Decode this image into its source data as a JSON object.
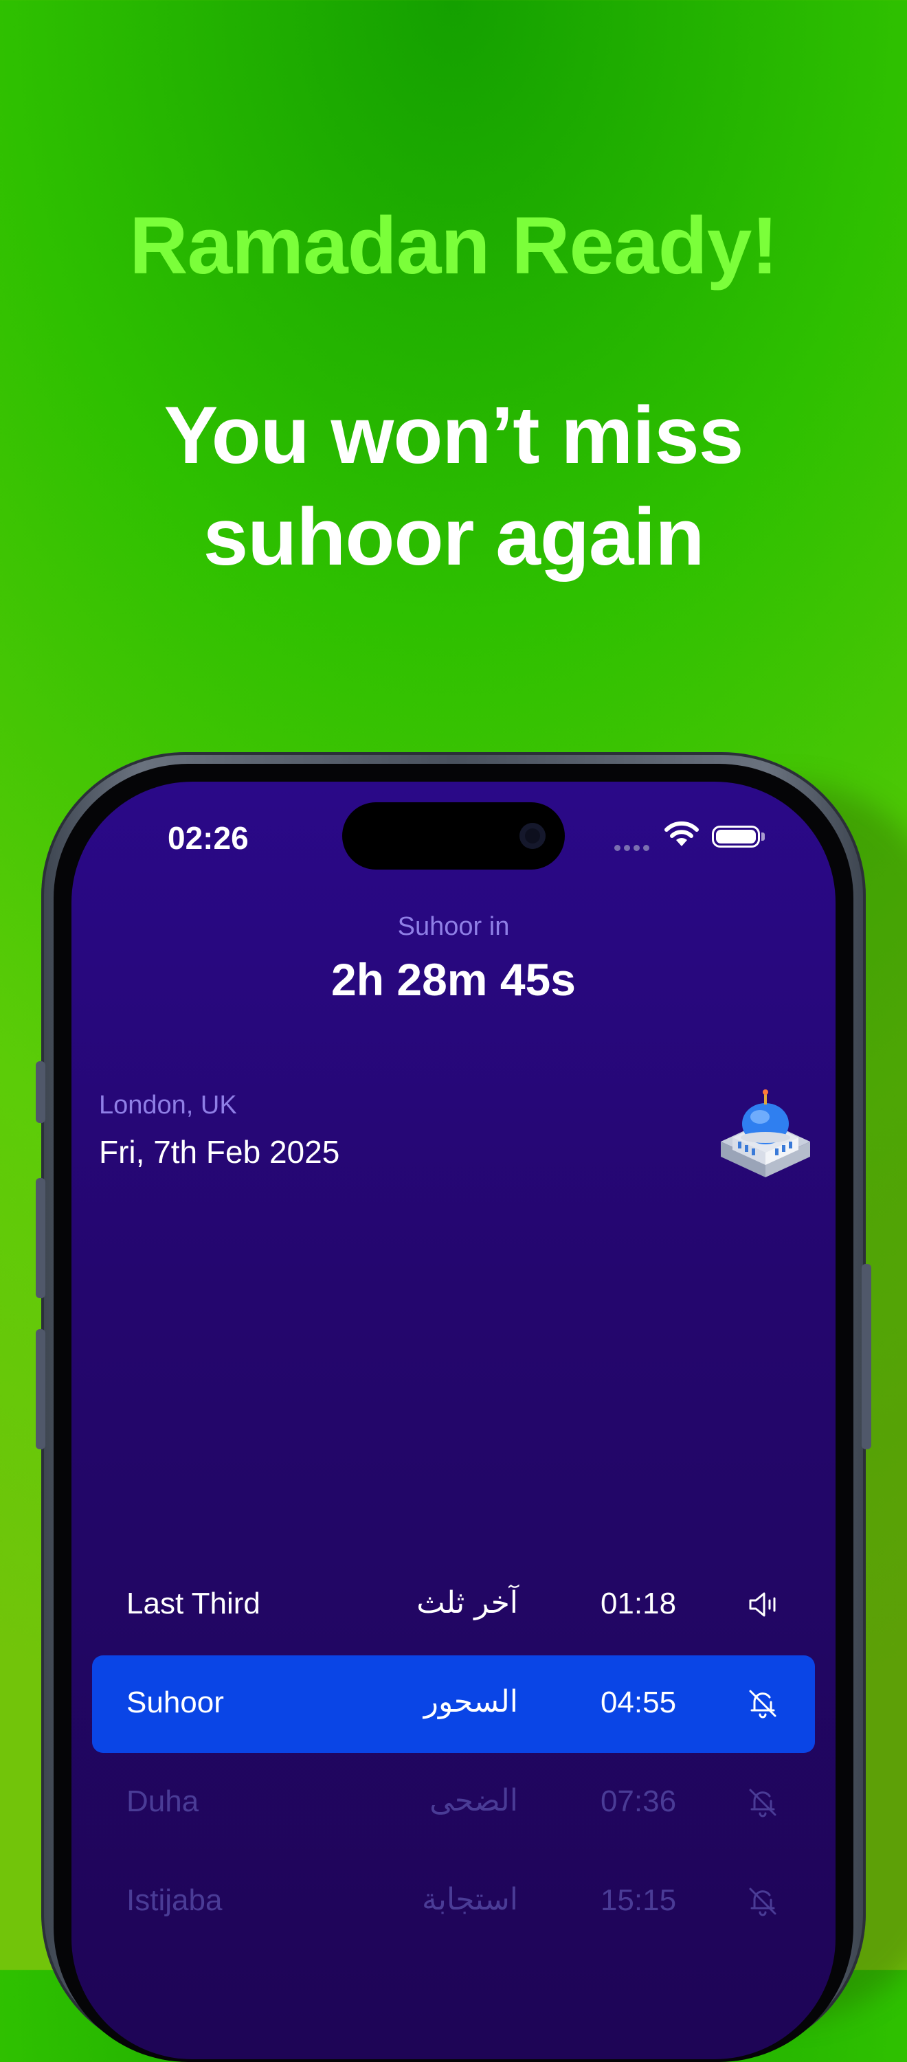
{
  "promo": {
    "headline": "Ramadan Ready!",
    "subhead_line1": "You won’t miss",
    "subhead_line2": "suhoor again"
  },
  "status_bar": {
    "time": "02:26"
  },
  "countdown": {
    "label": "Suhoor in",
    "value": "2h 28m 45s"
  },
  "location": {
    "place": "London, UK",
    "date": "Fri, 7th Feb 2025"
  },
  "prayers": [
    {
      "name": "Last Third",
      "arabic": "آخر ثلث",
      "time": "01:18",
      "alert": "speaker-icon",
      "state": "normal"
    },
    {
      "name": "Suhoor",
      "arabic": "السحور",
      "time": "04:55",
      "alert": "bell-off-icon",
      "state": "active"
    },
    {
      "name": "Duha",
      "arabic": "الضحى",
      "time": "07:36",
      "alert": "bell-off-icon",
      "state": "dim"
    },
    {
      "name": "Istijaba",
      "arabic": "استجابة",
      "time": "15:15",
      "alert": "bell-off-icon",
      "state": "dim"
    }
  ],
  "colors": {
    "background_green": "#2ec000",
    "headline_green": "#7bff3a",
    "screen_purple": "#24066e",
    "accent_purple": "#8f7fe6",
    "active_blue": "#0a45e6"
  }
}
